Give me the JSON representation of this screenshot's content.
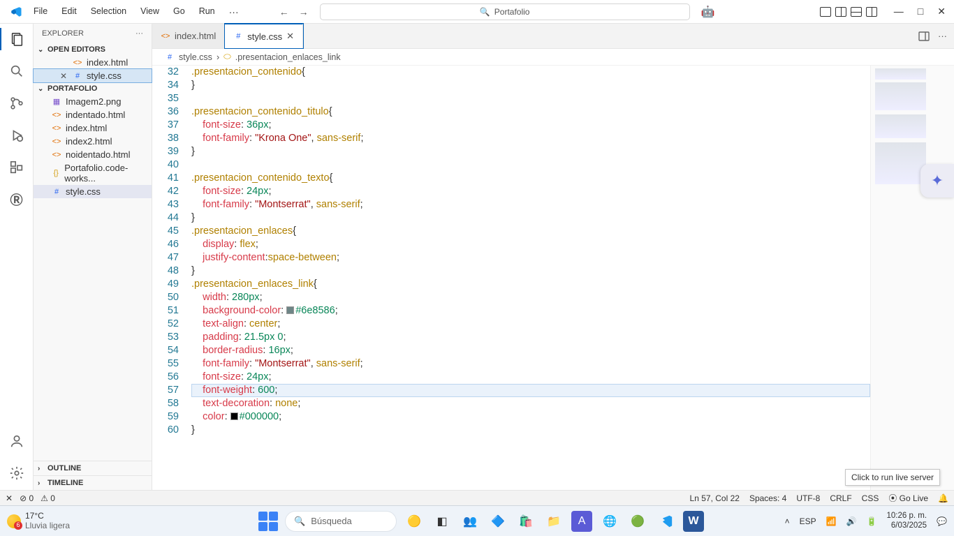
{
  "menu": {
    "file": "File",
    "edit": "Edit",
    "selection": "Selection",
    "view": "View",
    "go": "Go",
    "run": "Run",
    "more": "···"
  },
  "search": {
    "placeholder": "Portafolio"
  },
  "explorer": {
    "title": "EXPLORER",
    "openEditors": "OPEN EDITORS",
    "folder": "PORTAFOLIO",
    "outline": "OUTLINE",
    "timeline": "TIMELINE",
    "openFiles": [
      {
        "name": "index.html"
      },
      {
        "name": "style.css"
      }
    ],
    "files": [
      {
        "name": "Imagem2.png",
        "icon": "img"
      },
      {
        "name": "indentado.html",
        "icon": "html"
      },
      {
        "name": "index.html",
        "icon": "html"
      },
      {
        "name": "index2.html",
        "icon": "html"
      },
      {
        "name": "noidentado.html",
        "icon": "html"
      },
      {
        "name": "Portafolio.code-works...",
        "icon": "json"
      },
      {
        "name": "style.css",
        "icon": "css"
      }
    ]
  },
  "tabs": [
    {
      "label": "index.html",
      "active": false
    },
    {
      "label": "style.css",
      "active": true
    }
  ],
  "breadcrumb": {
    "file": "style.css",
    "symbol": ".presentacion_enlaces_link"
  },
  "code": {
    "startLine": 32,
    "lines": [
      {
        "n": 32,
        "html": "<span class='tk-sel'>.presentacion_contenido</span><span class='tk-punc'>{</span>"
      },
      {
        "n": 34,
        "html": "<span class='tk-punc'>}</span>"
      },
      {
        "n": 35,
        "html": ""
      },
      {
        "n": 36,
        "html": "<span class='tk-sel'>.presentacion_contenido_titulo</span><span class='tk-punc'>{</span>"
      },
      {
        "n": 37,
        "html": "    <span class='tk-prop'>font-size</span>: <span class='tk-num'>36px</span>;"
      },
      {
        "n": 38,
        "html": "    <span class='tk-prop'>font-family</span>: <span class='tk-str'>\"Krona One\"</span>, <span class='tk-val'>sans-serif</span>;"
      },
      {
        "n": 39,
        "html": "<span class='tk-punc'>}</span>"
      },
      {
        "n": 40,
        "html": ""
      },
      {
        "n": 41,
        "html": "<span class='tk-sel'>.presentacion_contenido_texto</span><span class='tk-punc'>{</span>"
      },
      {
        "n": 42,
        "html": "    <span class='tk-prop'>font-size</span>: <span class='tk-num'>24px</span>;"
      },
      {
        "n": 43,
        "html": "    <span class='tk-prop'>font-family</span>: <span class='tk-str'>\"Montserrat\"</span>, <span class='tk-val'>sans-serif</span>;"
      },
      {
        "n": 44,
        "html": "<span class='tk-punc'>}</span>"
      },
      {
        "n": 45,
        "html": "<span class='tk-sel'>.presentacion_enlaces</span><span class='tk-punc'>{</span>"
      },
      {
        "n": 46,
        "html": "    <span class='tk-prop'>display</span>: <span class='tk-val'>flex</span>;"
      },
      {
        "n": 47,
        "html": "    <span class='tk-prop'>justify-content</span>:<span class='tk-val'>space-between</span>;"
      },
      {
        "n": 48,
        "html": "<span class='tk-punc'>}</span>"
      },
      {
        "n": 49,
        "html": "<span class='tk-sel'>.presentacion_enlaces_link</span><span class='tk-punc'>{</span>"
      },
      {
        "n": 50,
        "html": "    <span class='tk-prop'>width</span>: <span class='tk-num'>280px</span>;"
      },
      {
        "n": 51,
        "html": "    <span class='tk-prop'>background-color</span>: <span class='color-swatch' style='background:#6e8586'></span><span class='tk-num'>#6e8586</span>;"
      },
      {
        "n": 52,
        "html": "    <span class='tk-prop'>text-align</span>: <span class='tk-val'>center</span>;"
      },
      {
        "n": 53,
        "html": "    <span class='tk-prop'>padding</span>: <span class='tk-num'>21.5px</span> <span class='tk-num'>0</span>;"
      },
      {
        "n": 54,
        "html": "    <span class='tk-prop'>border-radius</span>: <span class='tk-num'>16px</span>;"
      },
      {
        "n": 55,
        "html": "    <span class='tk-prop'>font-family</span>: <span class='tk-str'>\"Montserrat\"</span>, <span class='tk-val'>sans-serif</span>;"
      },
      {
        "n": 56,
        "html": "    <span class='tk-prop'>font-size</span>: <span class='tk-num'>24px</span>;"
      },
      {
        "n": 57,
        "html": "    <span class='tk-prop'>font-weight</span>: <span class='tk-num'>600</span>;",
        "current": true
      },
      {
        "n": 58,
        "html": "    <span class='tk-prop'>text-decoration</span>: <span class='tk-val'>none</span>;"
      },
      {
        "n": 59,
        "html": "    <span class='tk-prop'>color</span>: <span class='color-swatch' style='background:#000000'></span><span class='tk-num'>#000000</span>;"
      },
      {
        "n": 60,
        "html": "<span class='tk-punc'>}</span>"
      }
    ]
  },
  "tooltip": "Click to run live server",
  "status": {
    "remote": "✕",
    "errors": "⊘ 0",
    "warnings": "⚠ 0",
    "pos": "Ln 57, Col 22",
    "spaces": "Spaces: 4",
    "encoding": "UTF-8",
    "eol": "CRLF",
    "lang": "CSS",
    "golive": "⦿ Go Live",
    "bell": "🔔"
  },
  "taskbar": {
    "weather": {
      "temp": "17°C",
      "desc": "Lluvia ligera",
      "badge": "6"
    },
    "search": "Búsqueda",
    "tray": {
      "lang": "ESP",
      "time": "10:26 p. m.",
      "date": "6/03/2025"
    }
  }
}
